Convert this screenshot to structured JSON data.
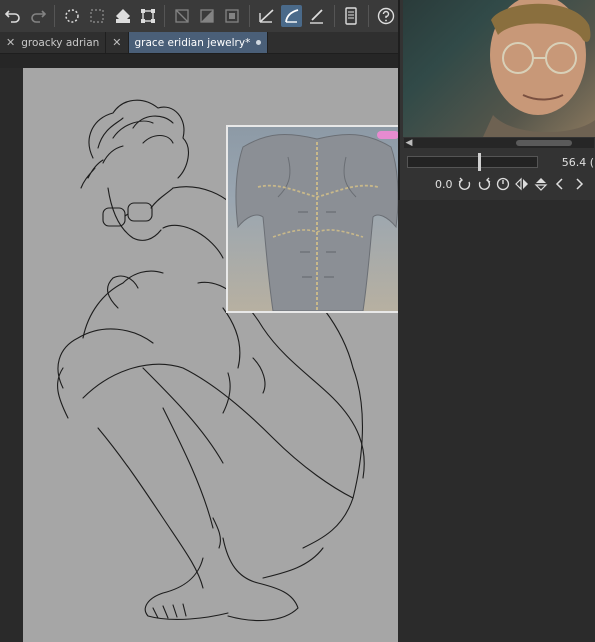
{
  "toolbar": {
    "buttons": [
      {
        "icon": "undo-icon",
        "state": "normal"
      },
      {
        "icon": "redo-icon",
        "state": "dim"
      },
      {
        "icon": "magic-wand-select-icon",
        "state": "normal"
      },
      {
        "icon": "rectangle-select-icon",
        "state": "dim"
      },
      {
        "icon": "fill-bucket-icon",
        "state": "normal"
      },
      {
        "icon": "transform-icon",
        "state": "normal"
      },
      {
        "icon": "deselect-icon",
        "state": "dim"
      },
      {
        "icon": "invert-selection-icon",
        "state": "dim"
      },
      {
        "icon": "show-selection-icon",
        "state": "dim"
      },
      {
        "icon": "freehand-brush-icon",
        "state": "normal"
      },
      {
        "icon": "curve-brush-icon",
        "state": "active"
      },
      {
        "icon": "line-tool-icon",
        "state": "normal"
      },
      {
        "icon": "tablet-icon",
        "state": "normal"
      },
      {
        "icon": "help-icon",
        "state": "normal"
      }
    ]
  },
  "tabs": [
    {
      "label": "groacky adrian",
      "active": false
    },
    {
      "label": "grace eridian jewelry*",
      "active": true
    }
  ],
  "reference_panel": {
    "zoom_value": "56.4 (",
    "zoom_fraction": 0.52,
    "rotation_value": "0.0"
  },
  "colors": {
    "accent": "#4a5f78",
    "paper": "#a6a6a6",
    "panel_bg": "#333333"
  }
}
